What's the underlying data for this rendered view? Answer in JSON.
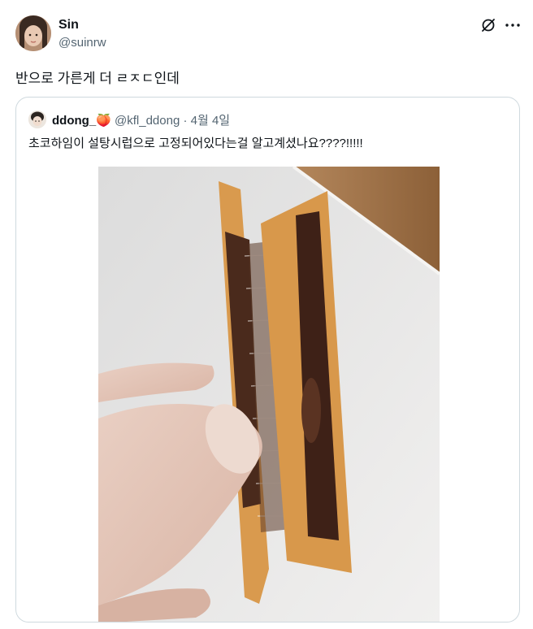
{
  "post": {
    "author_name": "Sin",
    "author_handle": "@suinrw",
    "text": "반으로 가른게 더 ㄹㅈㄷ인데",
    "icons": [
      "grok-icon",
      "more-icon"
    ]
  },
  "quote": {
    "author_name": "ddong_",
    "author_emoji": "🍑",
    "author_handle": "@kfl_ddong",
    "separator": "·",
    "date": "4월 4일",
    "text": "초코하임이 설탕시럽으로 고정되어있다는걸 알고계셨나요????!!!!!",
    "media": {
      "description_icon": "photo"
    }
  },
  "colors": {
    "text": "#0f1419",
    "secondary": "#536471",
    "border": "#cfd9de"
  }
}
